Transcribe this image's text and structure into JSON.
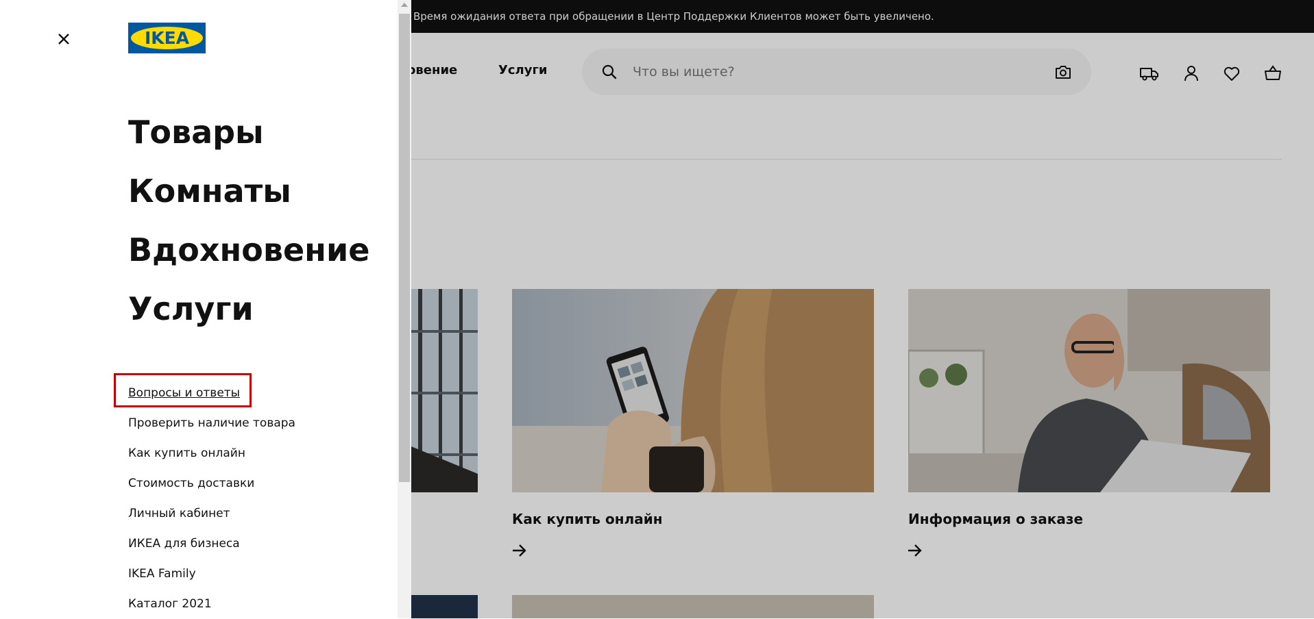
{
  "banner": {
    "text": "Время ожидания ответа при обращении в Центр Поддержки Клиентов может быть увеличено."
  },
  "header": {
    "nav": {
      "inspiration": "хновение",
      "services": "Услуги"
    },
    "search": {
      "placeholder": "Что вы ищете?",
      "search_icon": "search-icon",
      "camera_icon": "camera-icon"
    },
    "icons": [
      "truck-icon",
      "user-icon",
      "heart-icon",
      "cart-icon"
    ]
  },
  "cards": [
    {
      "title": "Как купить онлайн",
      "arrow_icon": "arrow-right-icon"
    },
    {
      "title": "Информация о заказе",
      "arrow_icon": "arrow-right-icon"
    }
  ],
  "drawer": {
    "close_icon": "close-icon",
    "logo_text": "IKEA",
    "main_menu": [
      {
        "label": "Товары"
      },
      {
        "label": "Комнаты"
      },
      {
        "label": "Вдохновение"
      },
      {
        "label": "Услуги"
      }
    ],
    "sub_menu": [
      {
        "label": "Вопросы и ответы"
      },
      {
        "label": "Проверить наличие товара"
      },
      {
        "label": "Как купить онлайн"
      },
      {
        "label": "Стоимость доставки"
      },
      {
        "label": "Личный кабинет"
      },
      {
        "label": "ИКЕА для бизнеса"
      },
      {
        "label": "IKEA Family"
      },
      {
        "label": "Каталог 2021"
      }
    ]
  },
  "colors": {
    "highlight": "#c00000",
    "ikea_blue": "#0058a3",
    "ikea_yellow": "#ffdb00"
  }
}
